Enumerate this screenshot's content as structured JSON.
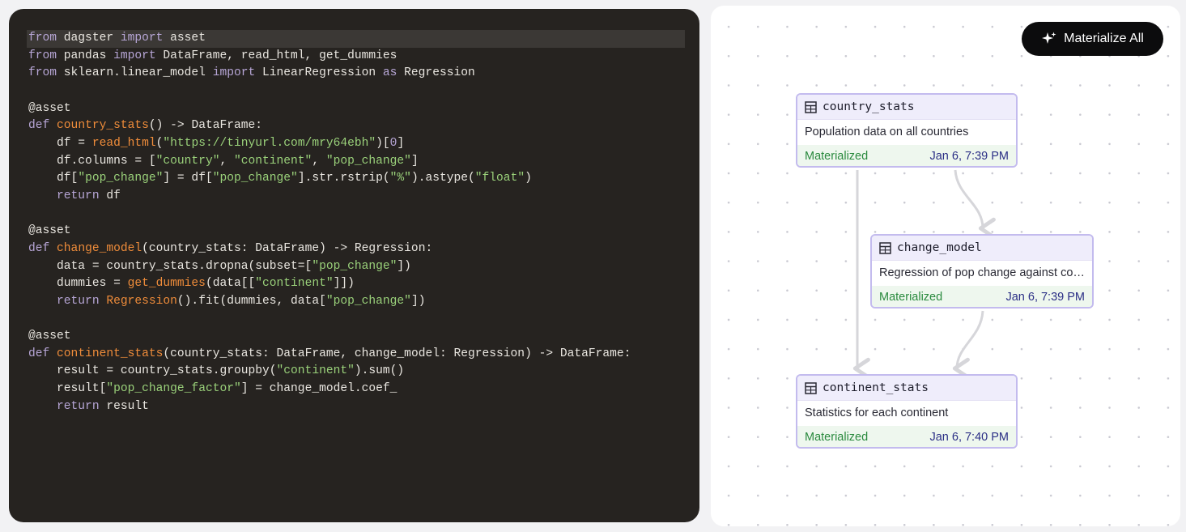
{
  "code": {
    "lines": [
      [
        [
          "kw",
          "from"
        ],
        [
          "plain",
          " dagster "
        ],
        [
          "kw",
          "import"
        ],
        [
          "plain",
          " asset"
        ]
      ],
      [
        [
          "kw",
          "from"
        ],
        [
          "plain",
          " pandas "
        ],
        [
          "kw",
          "import"
        ],
        [
          "plain",
          " DataFrame, read_html, get_dummies"
        ]
      ],
      [
        [
          "kw",
          "from"
        ],
        [
          "plain",
          " sklearn.linear_model "
        ],
        [
          "kw",
          "import"
        ],
        [
          "plain",
          " LinearRegression "
        ],
        [
          "kw",
          "as"
        ],
        [
          "plain",
          " Regression"
        ]
      ],
      [],
      [
        [
          "plain",
          "@asset"
        ]
      ],
      [
        [
          "kw",
          "def"
        ],
        [
          "plain",
          " "
        ],
        [
          "fn",
          "country_stats"
        ],
        [
          "plain",
          "() -> DataFrame:"
        ]
      ],
      [
        [
          "plain",
          "    df = "
        ],
        [
          "fn",
          "read_html"
        ],
        [
          "plain",
          "("
        ],
        [
          "str",
          "\"https://tinyurl.com/mry64ebh\""
        ],
        [
          "plain",
          ")["
        ],
        [
          "num",
          "0"
        ],
        [
          "plain",
          "]"
        ]
      ],
      [
        [
          "plain",
          "    df.columns = ["
        ],
        [
          "str",
          "\"country\""
        ],
        [
          "plain",
          ", "
        ],
        [
          "str",
          "\"continent\""
        ],
        [
          "plain",
          ", "
        ],
        [
          "str",
          "\"pop_change\""
        ],
        [
          "plain",
          "]"
        ]
      ],
      [
        [
          "plain",
          "    df["
        ],
        [
          "str",
          "\"pop_change\""
        ],
        [
          "plain",
          "] = df["
        ],
        [
          "str",
          "\"pop_change\""
        ],
        [
          "plain",
          "].str.rstrip("
        ],
        [
          "str",
          "\"%\""
        ],
        [
          "plain",
          ").astype("
        ],
        [
          "str",
          "\"float\""
        ],
        [
          "plain",
          ")"
        ]
      ],
      [
        [
          "plain",
          "    "
        ],
        [
          "kw",
          "return"
        ],
        [
          "plain",
          " df"
        ]
      ],
      [],
      [
        [
          "plain",
          "@asset"
        ]
      ],
      [
        [
          "kw",
          "def"
        ],
        [
          "plain",
          " "
        ],
        [
          "fn",
          "change_model"
        ],
        [
          "plain",
          "(country_stats: DataFrame) -> Regression:"
        ]
      ],
      [
        [
          "plain",
          "    data = country_stats.dropna(subset=["
        ],
        [
          "str",
          "\"pop_change\""
        ],
        [
          "plain",
          "])"
        ]
      ],
      [
        [
          "plain",
          "    dummies = "
        ],
        [
          "fn",
          "get_dummies"
        ],
        [
          "plain",
          "(data[["
        ],
        [
          "str",
          "\"continent\""
        ],
        [
          "plain",
          "]])"
        ]
      ],
      [
        [
          "plain",
          "    "
        ],
        [
          "kw",
          "return"
        ],
        [
          "plain",
          " "
        ],
        [
          "fn",
          "Regression"
        ],
        [
          "plain",
          "().fit(dummies, data["
        ],
        [
          "str",
          "\"pop_change\""
        ],
        [
          "plain",
          "])"
        ]
      ],
      [],
      [
        [
          "plain",
          "@asset"
        ]
      ],
      [
        [
          "kw",
          "def"
        ],
        [
          "plain",
          " "
        ],
        [
          "fn",
          "continent_stats"
        ],
        [
          "plain",
          "(country_stats: DataFrame, change_model: Regression) -> DataFrame:"
        ]
      ],
      [
        [
          "plain",
          "    result = country_stats.groupby("
        ],
        [
          "str",
          "\"continent\""
        ],
        [
          "plain",
          ").sum()"
        ]
      ],
      [
        [
          "plain",
          "    result["
        ],
        [
          "str",
          "\"pop_change_factor\""
        ],
        [
          "plain",
          "] = change_model.coef_"
        ]
      ],
      [
        [
          "plain",
          "    "
        ],
        [
          "kw",
          "return"
        ],
        [
          "plain",
          " result"
        ]
      ]
    ]
  },
  "graph": {
    "materialize_button": {
      "label": "Materialize All",
      "icon": "sparkle-icon"
    },
    "nodes": {
      "country_stats": {
        "name": "country_stats",
        "description": "Population data on all countries",
        "status": "Materialized",
        "timestamp": "Jan 6, 7:39 PM",
        "icon": "table-icon"
      },
      "change_model": {
        "name": "change_model",
        "description": "Regression of pop change against continent",
        "status": "Materialized",
        "timestamp": "Jan 6, 7:39 PM",
        "icon": "table-icon"
      },
      "continent_stats": {
        "name": "continent_stats",
        "description": "Statistics for each continent",
        "status": "Materialized",
        "timestamp": "Jan 6, 7:40 PM",
        "icon": "table-icon"
      }
    },
    "colors": {
      "node_border": "#c3bbee",
      "node_header": "#efedfb",
      "status_bg": "#eef7ee",
      "status_text": "#2a8a3e",
      "timestamp_text": "#2b2f86",
      "edge": "#d6d6da"
    }
  }
}
